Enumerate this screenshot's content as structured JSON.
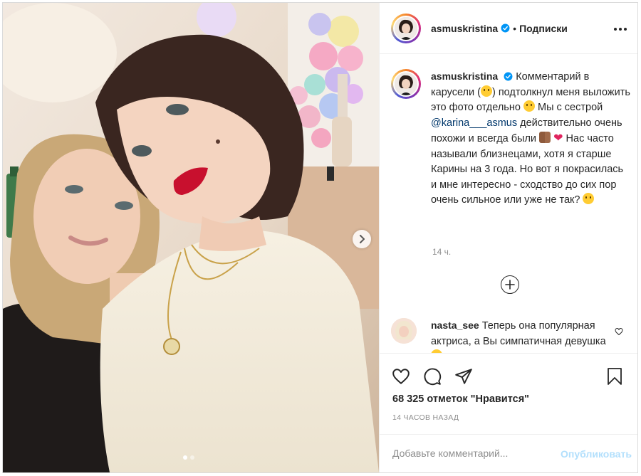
{
  "post": {
    "author": "asmuskristina",
    "follow_label": "Подписки",
    "dot_separator": "•",
    "caption": {
      "part1": "Комментарий в карусели (",
      "part2": ") подтолкнул меня выложить это фото отдельно ",
      "part3": " Мы с сестрой ",
      "mention": "@karina___asmus",
      "part4": " действительно очень похожи и всегда были ",
      "part5": " Нас часто называли близнецами, хотя я старше Карины на 3 года. Но вот я покрасилась и мне интересно - сходство до сих пор очень сильное или уже не так? "
    },
    "caption_time": "14 ч.",
    "comment": {
      "user": "nasta_see",
      "text": "Теперь она популярная актриса, а Вы симпатичная девушка "
    },
    "likes_text": "68 325 отметок \"Нравится\"",
    "post_time": "14 часов назад",
    "add_comment_placeholder": "Добавьте комментарий...",
    "publish_label": "Опубликовать",
    "carousel": {
      "current": 1,
      "total": 2
    }
  },
  "icons": {
    "more": "more-options-icon",
    "verified": "verified-badge-icon",
    "next": "chevron-right-icon",
    "load_more": "plus-circle-icon",
    "like": "heart-icon",
    "comment": "comment-icon",
    "share": "paper-plane-icon",
    "save": "bookmark-icon"
  },
  "colors": {
    "verified": "#0095f6",
    "text": "#262626",
    "muted": "#8e8e8e",
    "mention": "#00376b",
    "publish_disabled": "#b2dffc"
  }
}
